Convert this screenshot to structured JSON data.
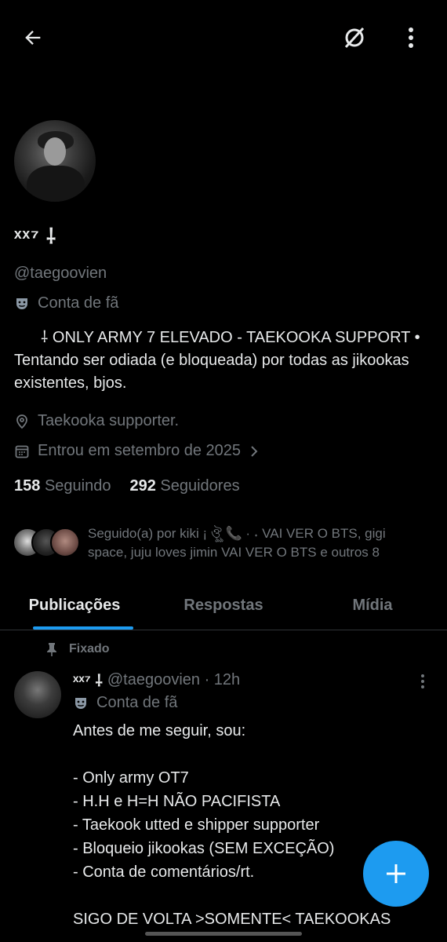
{
  "header": {
    "back_icon": "arrow-left-icon",
    "grok_icon": "grok-icon",
    "more_icon": "more-vertical-icon"
  },
  "profile": {
    "display_name": "ˣˣ⁷ ⸸",
    "handle": "@taegoovien",
    "badge_label": "Conta de fã",
    "bio": "⸸ ONLY ARMY 7 ELEVADO - TAEKOOKA SUPPORT • Tentando ser odiada (e bloqueada) por todas as jikookas existentes, bjos.",
    "location": "Taekooka supporter.",
    "joined": "Entrou em setembro de 2025",
    "following_count": "158",
    "following_label": "Seguindo",
    "followers_count": "292",
    "followers_label": "Seguidores",
    "followed_by": "Seguido(a) por kiki ¡ ঔৣ 📞 · ˖ VAI VER O BTS, gigi space, juju loves jimin VAI VER O BTS e outros 8"
  },
  "tabs": [
    {
      "label": "Publicações",
      "active": true
    },
    {
      "label": "Respostas",
      "active": false
    },
    {
      "label": "Mídia",
      "active": false
    }
  ],
  "post": {
    "pinned_label": "Fixado",
    "display_name": "ˣˣ⁷ ⸸",
    "handle_time": "@taegoovien · 12h",
    "badge_label": "Conta de fã",
    "text": "Antes de me seguir, sou:\n\n- Only army OT7\n- H.H e H=H NÃO PACIFISTA\n- Taekook utted e shipper supporter\n- Bloqueio jikookas (SEM EXCEÇÃO)\n- Conta de comentários/rt.\n\nSIGO DE VOLTA >SOMENTE< TAEKOOKAS"
  },
  "colors": {
    "accent": "#1d9bf0",
    "background": "#000000",
    "muted": "#71767b"
  }
}
